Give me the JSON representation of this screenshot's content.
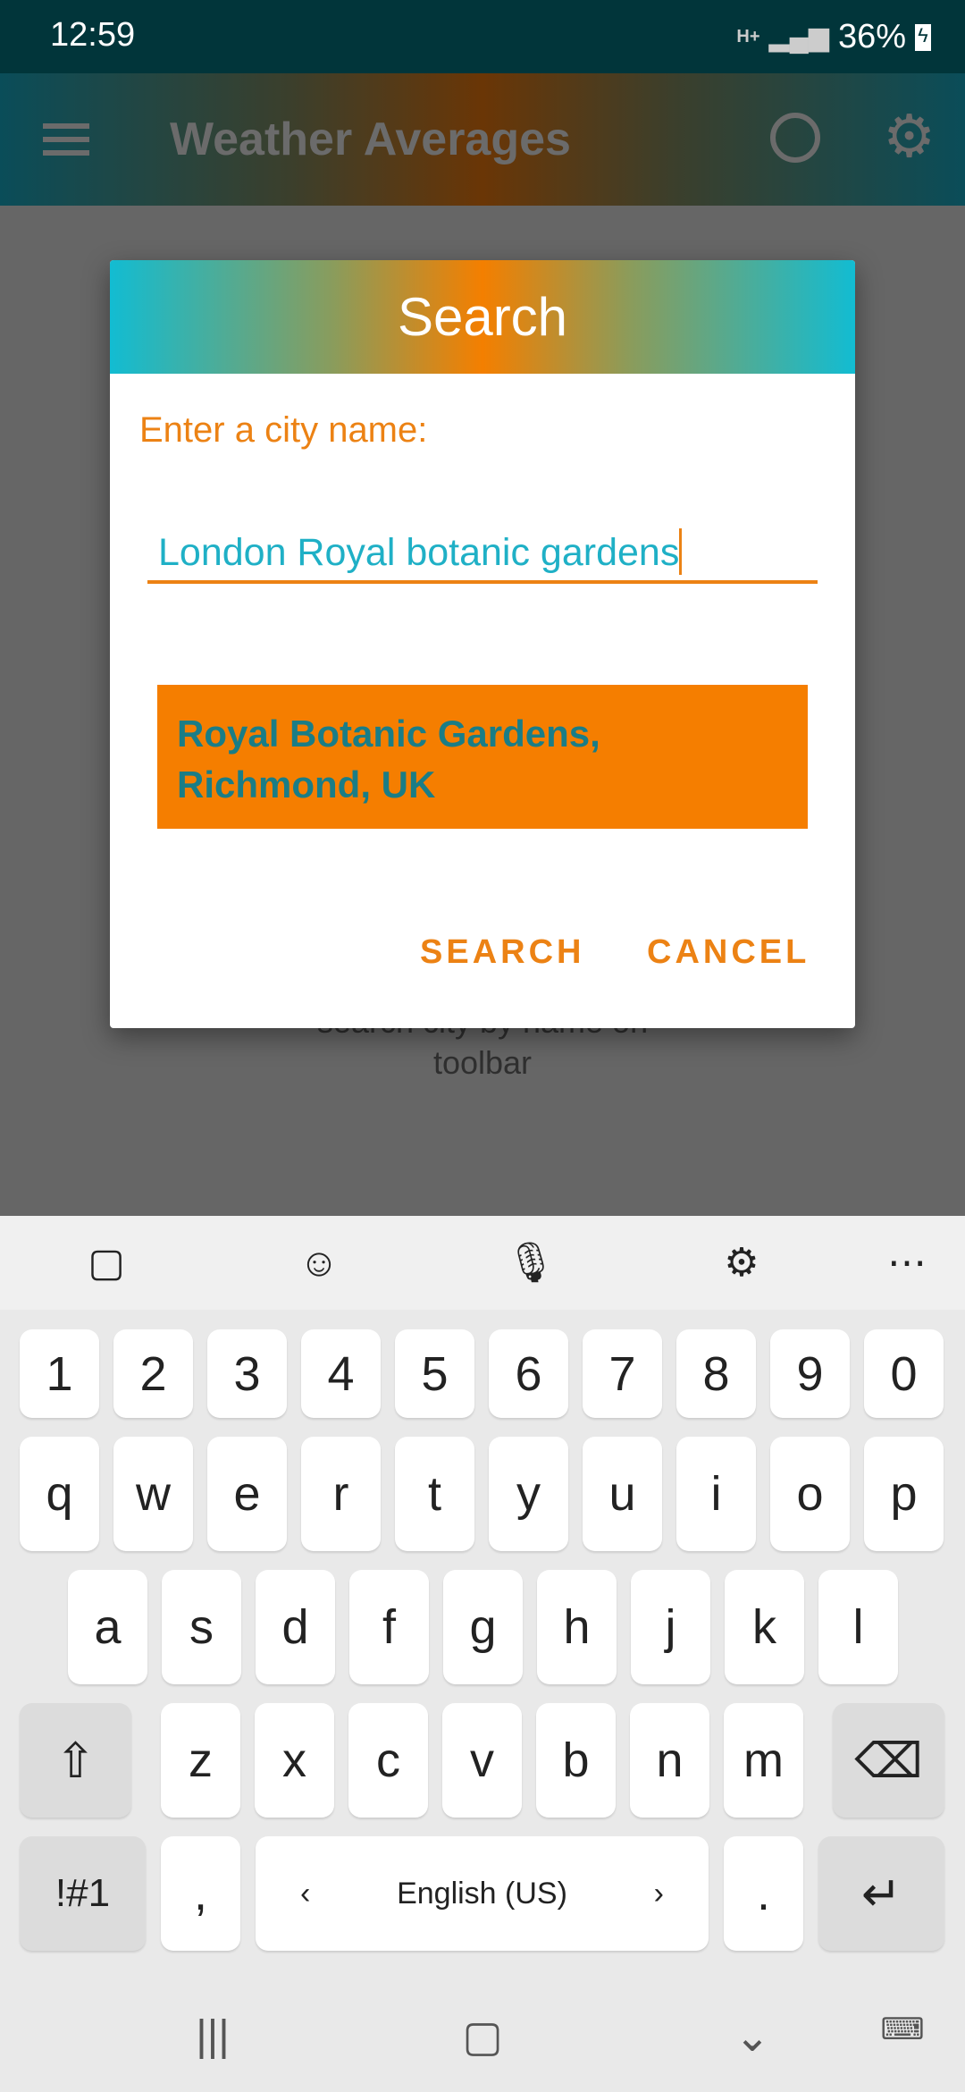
{
  "status_bar": {
    "time": "12:59",
    "network": "H+",
    "battery": "36%"
  },
  "toolbar": {
    "title": "Weather Averages",
    "icons": [
      "menu-icon",
      "locate-icon",
      "settings-icon"
    ]
  },
  "background_hint": {
    "line1": "search city by name on",
    "line2": "toolbar"
  },
  "dialog": {
    "title": "Search",
    "label": "Enter a city name:",
    "input_value": "London Royal botanic gardens",
    "suggestion": "Royal Botanic Gardens, Richmond, UK",
    "search_button": "SEARCH",
    "cancel_button": "CANCEL"
  },
  "colors": {
    "accent": "#f57e00",
    "teal": "#12bcd2",
    "status_bar": "#01353a"
  },
  "keyboard": {
    "toolbar_icons": [
      "sticker-icon",
      "emoji-icon",
      "microphone-icon",
      "settings-icon",
      "more-icon"
    ],
    "row_numbers": [
      "1",
      "2",
      "3",
      "4",
      "5",
      "6",
      "7",
      "8",
      "9",
      "0"
    ],
    "row_top": [
      "q",
      "w",
      "e",
      "r",
      "t",
      "y",
      "u",
      "i",
      "o",
      "p"
    ],
    "row_middle": [
      "a",
      "s",
      "d",
      "f",
      "g",
      "h",
      "j",
      "k",
      "l"
    ],
    "row_bottom": [
      "z",
      "x",
      "c",
      "v",
      "b",
      "n",
      "m"
    ],
    "symbols": "!#1",
    "comma": ",",
    "space": "English (US)",
    "period": ".",
    "space_left": "‹",
    "space_right": "›"
  },
  "nav_bar": {
    "icons": [
      "recents-icon",
      "home-icon",
      "back-icon",
      "keyboard-icon"
    ]
  }
}
